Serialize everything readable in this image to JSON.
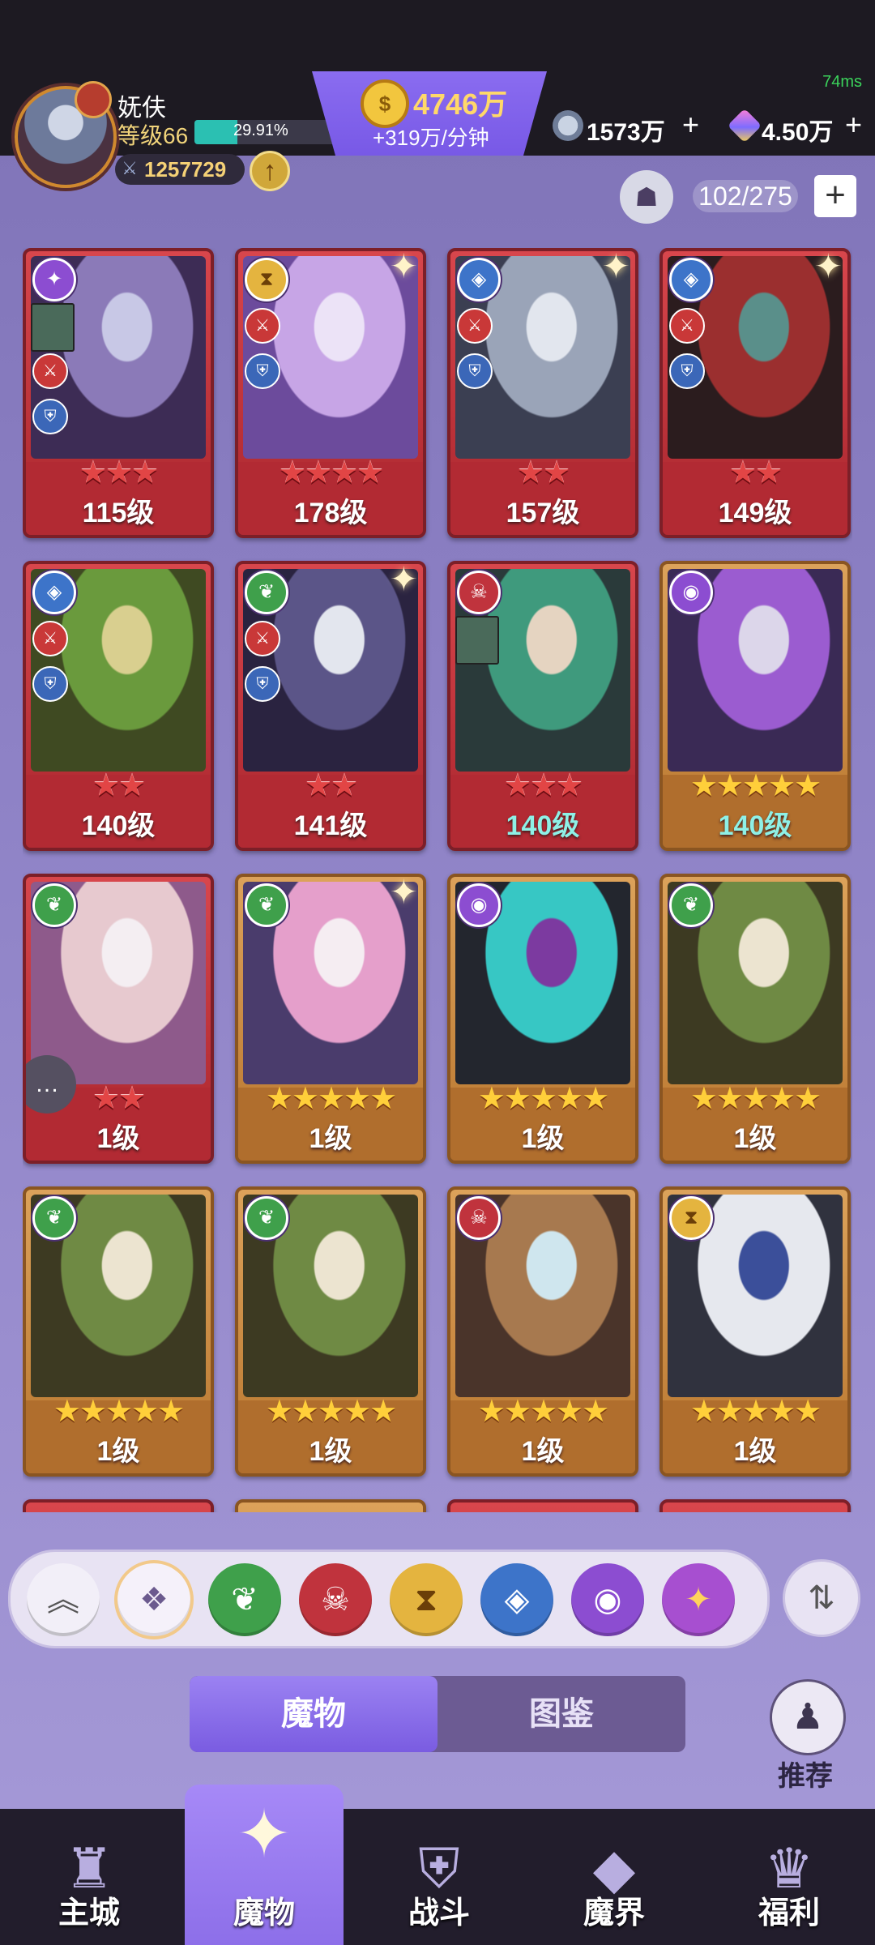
{
  "status": {
    "ping": "74ms"
  },
  "player": {
    "name": "妩伕",
    "level_label": "等级66",
    "xp_percent": "29.91%",
    "xp_fraction": 0.2991,
    "power": "1257729"
  },
  "resources": {
    "gold": "4746万",
    "gold_rate": "+319万/分钟",
    "silver": "1573万",
    "gems": "4.50万"
  },
  "roster": {
    "count": "102/275"
  },
  "cards": [
    {
      "frame": "red",
      "faction": "purple",
      "faction_glyph": "✦",
      "stars": "★★★",
      "level": "115级",
      "teal": false,
      "badges": true,
      "sparkle": false,
      "mini_hero": true,
      "art_colors": [
        "#8b7ab8",
        "#c8c8e6",
        "#3d2c55"
      ]
    },
    {
      "frame": "red",
      "faction": "gold",
      "faction_glyph": "⧗",
      "stars": "★★★★",
      "level": "178级",
      "teal": false,
      "badges": true,
      "sparkle": true,
      "mini_hero": false,
      "art_colors": [
        "#c7a5e6",
        "#ece3f7",
        "#6c4b9c"
      ]
    },
    {
      "frame": "red",
      "faction": "dragon",
      "faction_glyph": "◈",
      "stars": "★★",
      "level": "157级",
      "teal": false,
      "badges": true,
      "sparkle": true,
      "mini_hero": false,
      "art_colors": [
        "#9aa4b8",
        "#e2e6ee",
        "#3b3f52"
      ]
    },
    {
      "frame": "red",
      "faction": "dragon",
      "faction_glyph": "◈",
      "stars": "★★",
      "level": "149级",
      "teal": false,
      "badges": true,
      "sparkle": true,
      "mini_hero": false,
      "art_colors": [
        "#9b2f2f",
        "#5a8f8a",
        "#2b1c1e"
      ]
    },
    {
      "frame": "red",
      "faction": "dragon",
      "faction_glyph": "◈",
      "stars": "★★",
      "level": "140级",
      "teal": false,
      "badges": true,
      "sparkle": false,
      "mini_hero": false,
      "art_colors": [
        "#6a9a3d",
        "#d9cf8f",
        "#3f4a22"
      ]
    },
    {
      "frame": "red",
      "faction": "nature",
      "faction_glyph": "❦",
      "stars": "★★",
      "level": "141级",
      "teal": false,
      "badges": true,
      "sparkle": true,
      "mini_hero": false,
      "art_colors": [
        "#5b5588",
        "#e3e6ee",
        "#2a2340"
      ]
    },
    {
      "frame": "red",
      "faction": "demon",
      "faction_glyph": "☠",
      "stars": "★★★",
      "level": "140级",
      "teal": true,
      "badges": false,
      "sparkle": false,
      "mini_hero": true,
      "art_colors": [
        "#3f9a7d",
        "#e5d4c1",
        "#2a3a3a"
      ]
    },
    {
      "frame": "gold",
      "faction": "purple",
      "faction_glyph": "◉",
      "stars": "★★★★★",
      "level": "140级",
      "teal": true,
      "badges": false,
      "sparkle": false,
      "mini_hero": false,
      "art_colors": [
        "#9b5cd0",
        "#dcd6ea",
        "#3a2a55"
      ]
    },
    {
      "frame": "red",
      "faction": "nature",
      "faction_glyph": "❦",
      "stars": "★★",
      "level": "1级",
      "teal": false,
      "badges": false,
      "sparkle": false,
      "mini_hero": false,
      "art_colors": [
        "#e7c9cf",
        "#f4eef2",
        "#8e5a8b"
      ]
    },
    {
      "frame": "gold",
      "faction": "nature",
      "faction_glyph": "❦",
      "stars": "★★★★★",
      "level": "1级",
      "teal": false,
      "badges": false,
      "sparkle": true,
      "mini_hero": false,
      "art_colors": [
        "#e59fcb",
        "#f5edf2",
        "#4a3c6c"
      ]
    },
    {
      "frame": "gold",
      "faction": "purple",
      "faction_glyph": "◉",
      "stars": "★★★★★",
      "level": "1级",
      "teal": false,
      "badges": false,
      "sparkle": false,
      "mini_hero": false,
      "art_colors": [
        "#37c7c4",
        "#7c3aa0",
        "#23262e"
      ]
    },
    {
      "frame": "gold",
      "faction": "nature",
      "faction_glyph": "❦",
      "stars": "★★★★★",
      "level": "1级",
      "teal": false,
      "badges": false,
      "sparkle": false,
      "mini_hero": false,
      "art_colors": [
        "#6f8a44",
        "#ece4d0",
        "#3d3a22"
      ]
    },
    {
      "frame": "gold",
      "faction": "nature",
      "faction_glyph": "❦",
      "stars": "★★★★★",
      "level": "1级",
      "teal": false,
      "badges": false,
      "sparkle": false,
      "mini_hero": false,
      "art_colors": [
        "#6f8a44",
        "#ece4d0",
        "#3d3a22"
      ]
    },
    {
      "frame": "gold",
      "faction": "nature",
      "faction_glyph": "❦",
      "stars": "★★★★★",
      "level": "1级",
      "teal": false,
      "badges": false,
      "sparkle": false,
      "mini_hero": false,
      "art_colors": [
        "#6f8a44",
        "#ece4d0",
        "#3d3a22"
      ]
    },
    {
      "frame": "gold",
      "faction": "demon",
      "faction_glyph": "☠",
      "stars": "★★★★★",
      "level": "1级",
      "teal": false,
      "badges": false,
      "sparkle": false,
      "mini_hero": false,
      "art_colors": [
        "#a7794f",
        "#cfe6ee",
        "#4a342a"
      ]
    },
    {
      "frame": "gold",
      "faction": "gold",
      "faction_glyph": "⧗",
      "stars": "★★★★★",
      "level": "1级",
      "teal": false,
      "badges": false,
      "sparkle": false,
      "mini_hero": false,
      "art_colors": [
        "#e6e8ee",
        "#3b4f9a",
        "#30323e"
      ]
    }
  ],
  "filters": [
    {
      "name": "collapse",
      "glyph": "︽",
      "color": "#f2eff8",
      "fg": "#555"
    },
    {
      "name": "all",
      "glyph": "❖",
      "color": "#f5f1fa",
      "fg": "#6b5a8e"
    },
    {
      "name": "nature",
      "glyph": "❦",
      "color": "#3fa04b",
      "fg": "#fff"
    },
    {
      "name": "demon",
      "glyph": "☠",
      "color": "#c0333d",
      "fg": "#fff"
    },
    {
      "name": "time",
      "glyph": "⧗",
      "color": "#e4b43f",
      "fg": "#6b3f08"
    },
    {
      "name": "dragon",
      "glyph": "◈",
      "color": "#3d74c9",
      "fg": "#fff"
    },
    {
      "name": "eye",
      "glyph": "◉",
      "color": "#8c4dd1",
      "fg": "#fff"
    },
    {
      "name": "chaos",
      "glyph": "✦",
      "color": "#a74fd0",
      "fg": "#ffd35c"
    }
  ],
  "tabs": {
    "active": "魔物",
    "inactive": "图鉴"
  },
  "recommend": {
    "label": "推荐"
  },
  "nav": [
    {
      "label": "主城",
      "glyph": "♜",
      "active": false
    },
    {
      "label": "魔物",
      "glyph": "✦",
      "active": true
    },
    {
      "label": "战斗",
      "glyph": "⛨",
      "active": false
    },
    {
      "label": "魔界",
      "glyph": "◆",
      "active": false
    },
    {
      "label": "福利",
      "glyph": "♛",
      "active": false
    }
  ]
}
